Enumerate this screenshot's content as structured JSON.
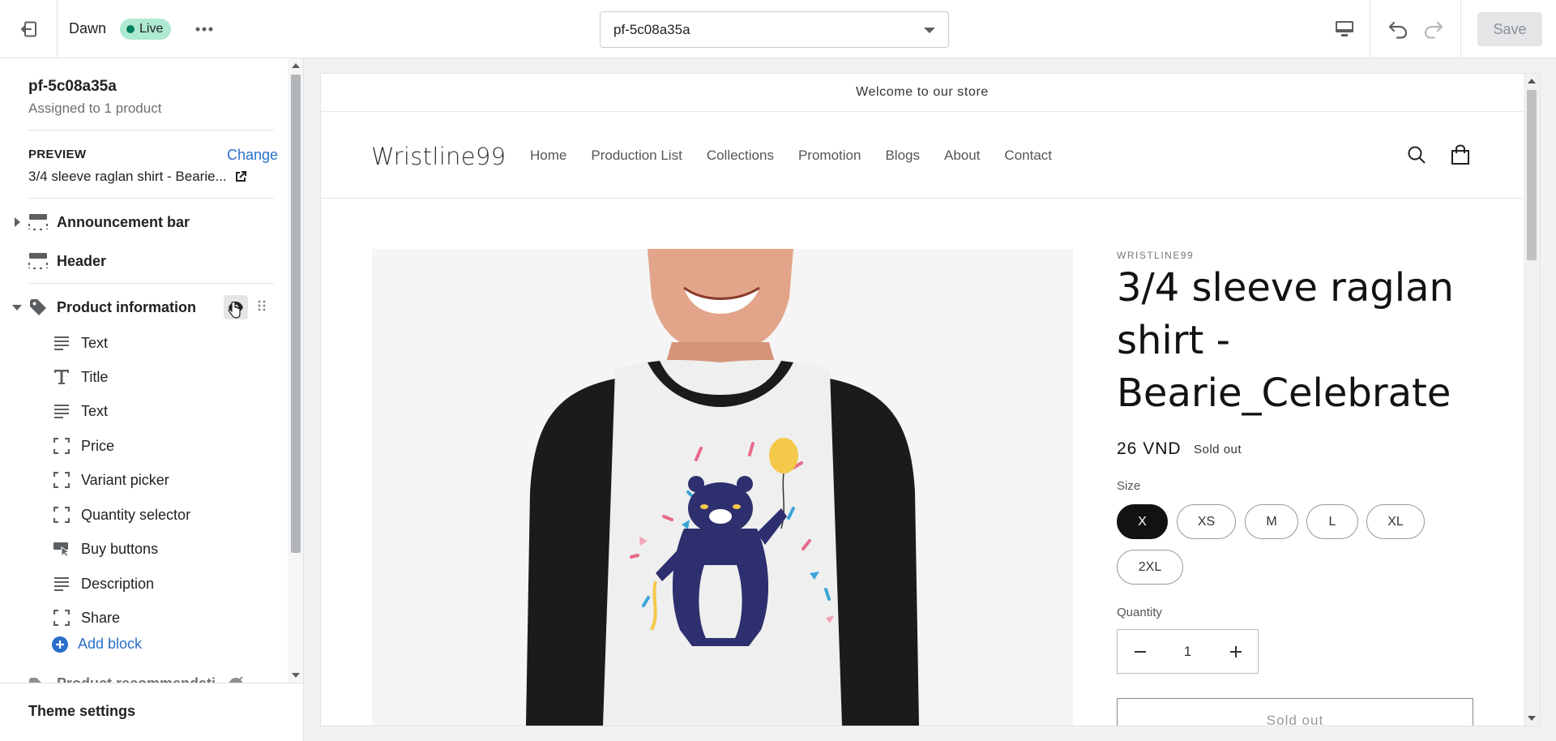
{
  "topbar": {
    "exit_icon": "exit-icon",
    "theme_name": "Dawn",
    "status_badge": "Live",
    "more_icon": "ellipsis-icon",
    "template_select_value": "pf-5c08a35a",
    "device_icon": "desktop-icon",
    "undo_icon": "undo-icon",
    "redo_icon": "redo-icon",
    "save_label": "Save"
  },
  "sidebar": {
    "template_title": "pf-5c08a35a",
    "assigned_text": "Assigned to 1 product",
    "preview_label": "PREVIEW",
    "change_label": "Change",
    "preview_product": "3/4 sleeve raglan shirt - Bearie...",
    "sections": [
      {
        "label": "Announcement bar",
        "icon": "section-icon",
        "expanded": false
      },
      {
        "label": "Header",
        "icon": "section-icon"
      },
      {
        "label": "Product information",
        "icon": "tag-icon",
        "expanded": true
      }
    ],
    "blocks": [
      {
        "label": "Text",
        "icon": "text-lines-icon"
      },
      {
        "label": "Title",
        "icon": "title-icon"
      },
      {
        "label": "Text",
        "icon": "text-lines-icon"
      },
      {
        "label": "Price",
        "icon": "block-icon"
      },
      {
        "label": "Variant picker",
        "icon": "block-icon"
      },
      {
        "label": "Quantity selector",
        "icon": "block-icon"
      },
      {
        "label": "Buy buttons",
        "icon": "buy-buttons-icon"
      },
      {
        "label": "Description",
        "icon": "text-lines-icon"
      },
      {
        "label": "Share",
        "icon": "block-icon"
      }
    ],
    "add_block_label": "Add block",
    "next_section_label": "Product recommendati",
    "theme_settings_label": "Theme settings"
  },
  "store": {
    "announcement": "Welcome to our store",
    "logo": "Wristline99",
    "nav": [
      "Home",
      "Production List",
      "Collections",
      "Promotion",
      "Blogs",
      "About",
      "Contact"
    ],
    "vendor": "WRISTLINE99",
    "product_title": "3/4 sleeve raglan shirt - Bearie_Celebrate",
    "price": "26 VND",
    "sold_out_badge": "Sold out",
    "size_label": "Size",
    "sizes": [
      "X",
      "XS",
      "M",
      "L",
      "XL",
      "2XL"
    ],
    "selected_size": "X",
    "quantity_label": "Quantity",
    "quantity_value": "1",
    "sold_out_button": "Sold out"
  },
  "colors": {
    "accent": "#2c6ecb",
    "live_badge": "#aee9d1",
    "shirt_body": "#efefef",
    "shirt_sleeves": "#1b1b1b",
    "bear": "#2e2f6e"
  }
}
